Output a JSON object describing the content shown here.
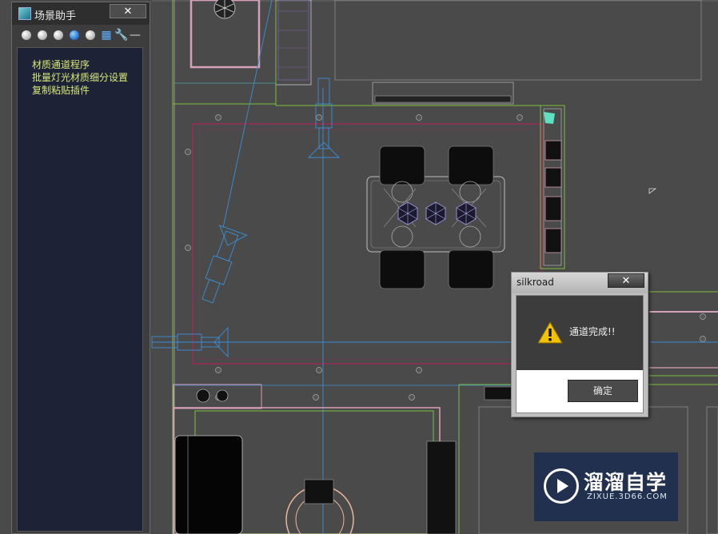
{
  "panel": {
    "title": "场景助手",
    "close": "✕",
    "toolbar": {
      "dots": [
        "white",
        "white",
        "white",
        "blue",
        "white"
      ],
      "tools": [
        "layer-icon",
        "wrench-icon",
        "minus-icon"
      ]
    },
    "items": [
      "材质通道程序",
      "批量灯光材质细分设置",
      "复制粘贴插件"
    ]
  },
  "dialog": {
    "title": "silkroad",
    "close": "✕",
    "icon": "warning-icon",
    "message": "通道完成!!",
    "ok": "确定"
  },
  "watermark": {
    "title": "溜溜自学",
    "url": "ZIXUE.3D66.COM"
  },
  "colors": {
    "background": "#4a4a4a",
    "panel_list_bg": "#1e2236",
    "panel_list_text": "#d6e87a",
    "wire_green": "#7fbf3f",
    "wire_pink": "#d7a0b8",
    "wire_red": "#9a2a55",
    "wire_blue": "#3a8fd6",
    "wire_white": "#c8c8c8"
  }
}
